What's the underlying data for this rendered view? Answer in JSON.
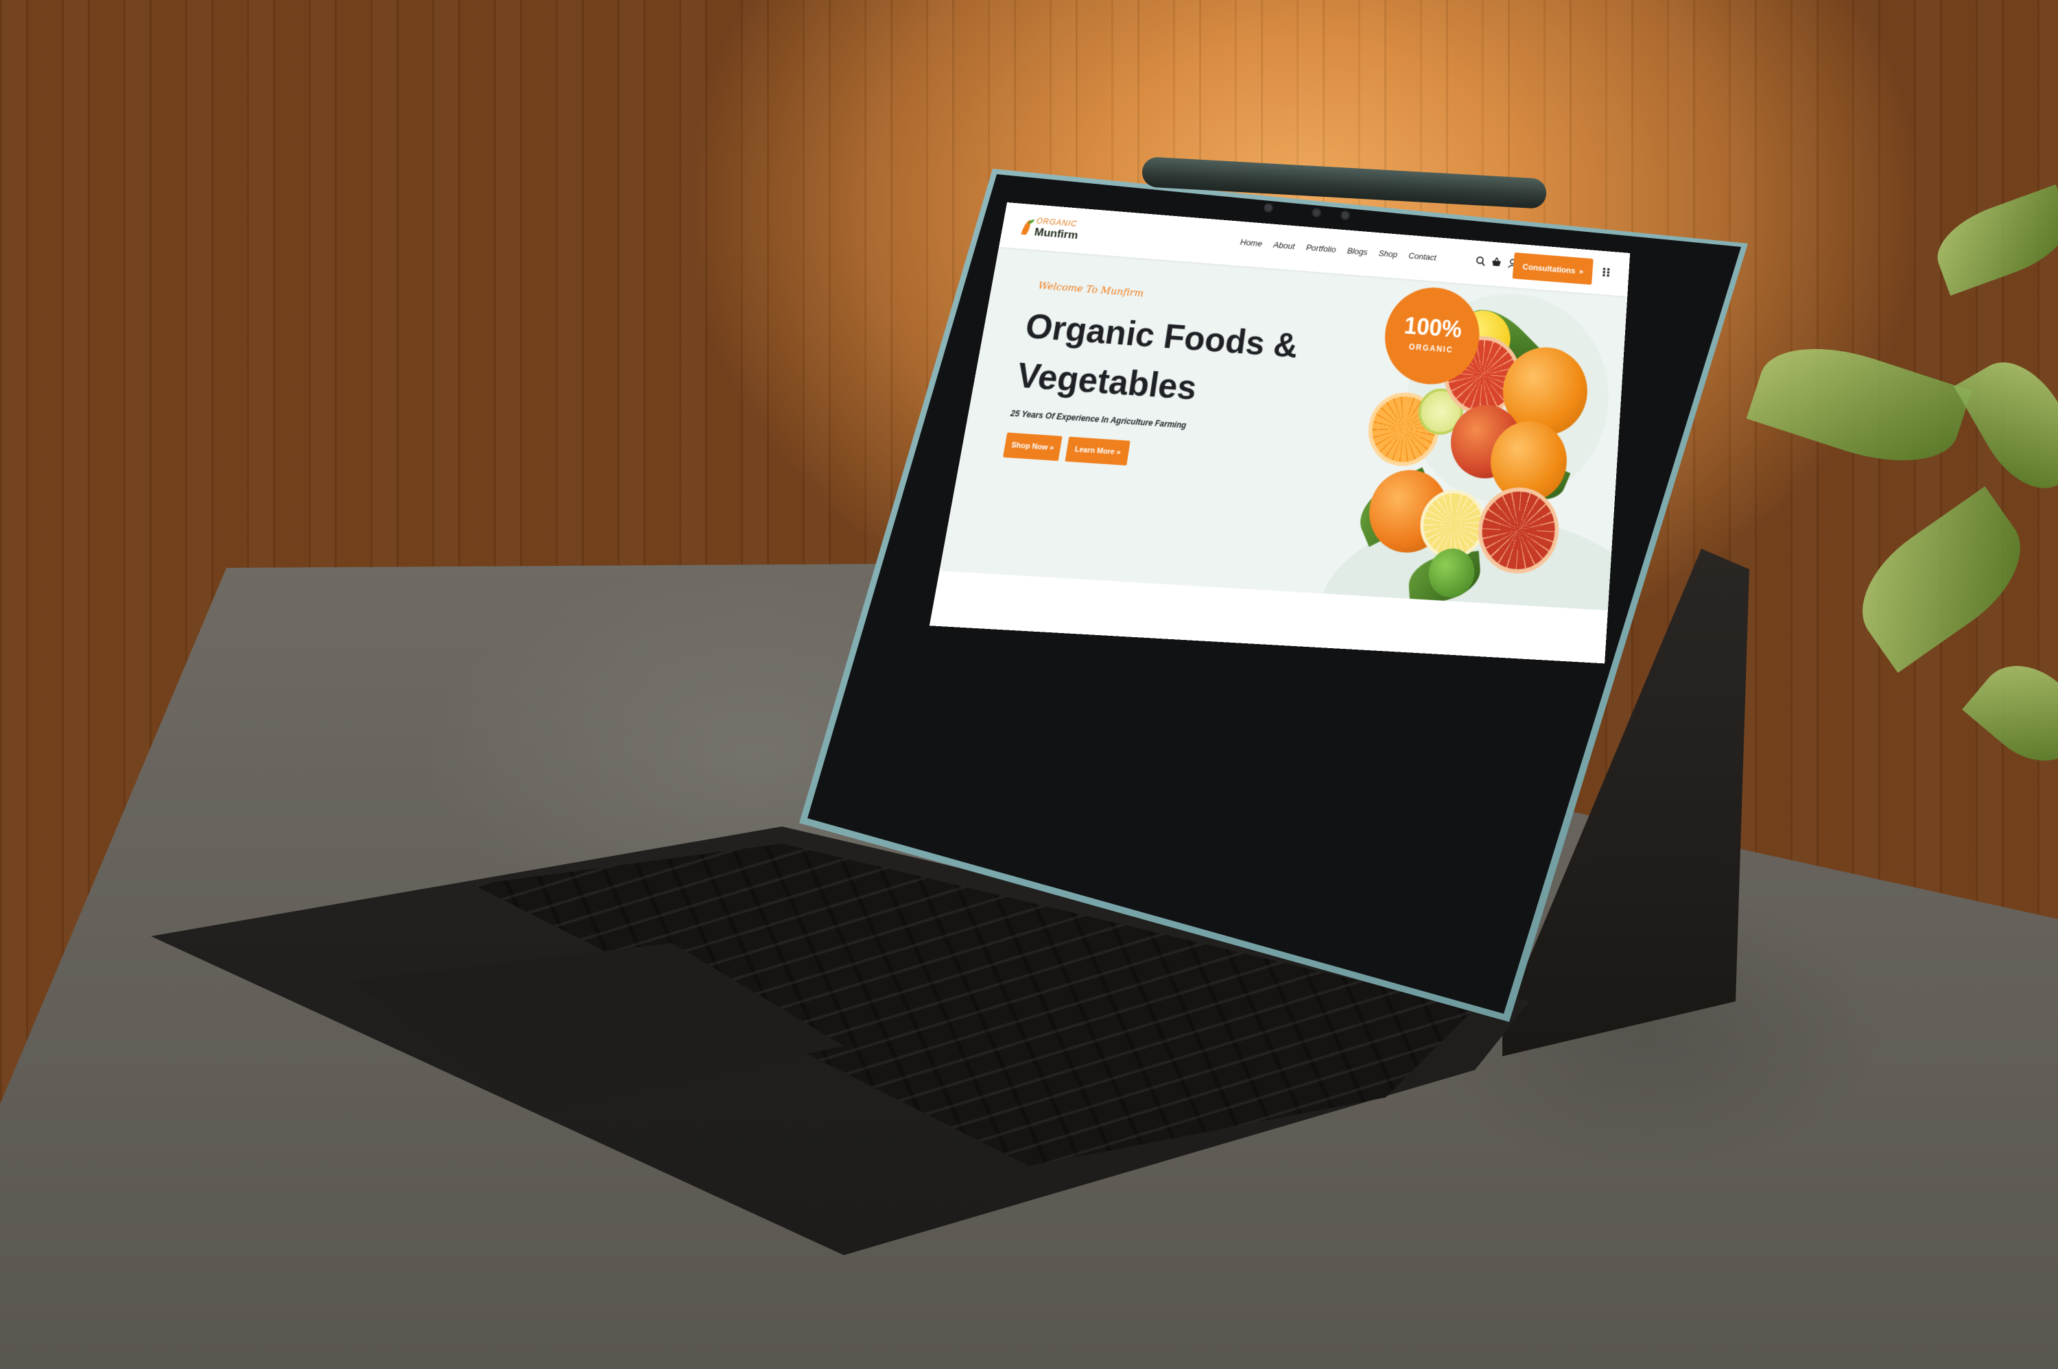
{
  "website": {
    "logo": {
      "top_text": "ORGANIC",
      "bottom_text": "Munfirm"
    },
    "nav": [
      "Home",
      "About",
      "Portfolio",
      "Blogs",
      "Shop",
      "Contact"
    ],
    "nav_icons": [
      "search-icon",
      "basket-icon",
      "user-icon"
    ],
    "cta_button": "Consultations",
    "cta_icon": "double-chevron-right-icon",
    "menu_icon": "grid-dots-icon",
    "hero": {
      "welcome": "Welcome To Munfirm",
      "title": "Organic Foods & Vegetables",
      "subtitle": "25 Years Of Experience In Agriculture Farming",
      "buttons": [
        "Shop Now",
        "Learn More"
      ]
    },
    "badge": {
      "big": "100%",
      "small": "ORGANIC"
    }
  },
  "colors": {
    "accent": "#f07f1e",
    "text_dark": "#1e2025",
    "hero_bg": "#eef4f2",
    "tablet_frame": "#8fb8bc"
  }
}
